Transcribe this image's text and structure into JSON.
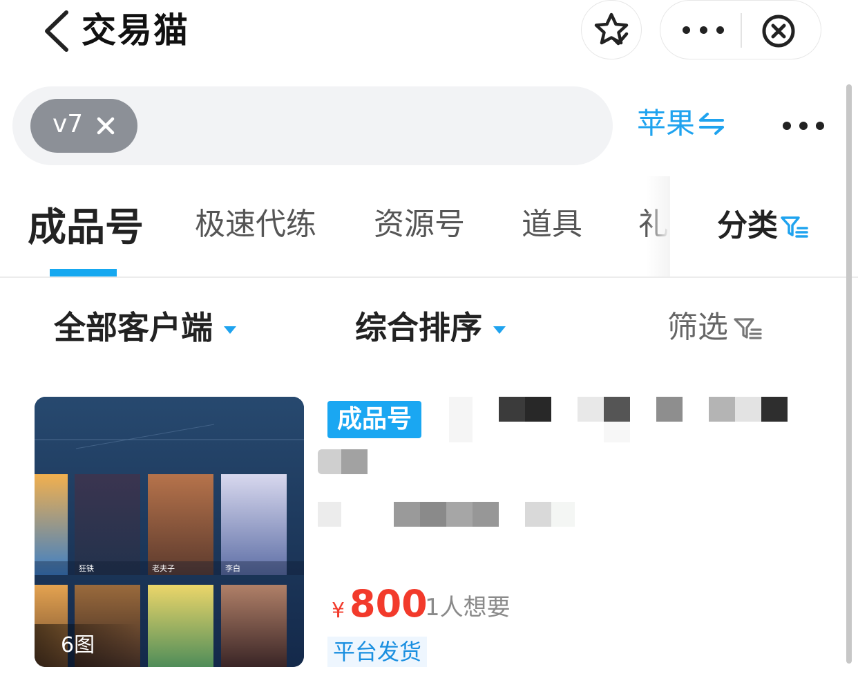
{
  "header": {
    "title": "交易猫",
    "back_icon": "chevron-left-icon",
    "favorite_icon": "star-check-icon",
    "more_icon": "more-dots-icon",
    "close_icon": "close-circle-icon"
  },
  "search": {
    "chip_label": "v7",
    "platform_label": "苹果",
    "platform_icon": "swap-icon"
  },
  "tabs": {
    "items": [
      "成品号",
      "极速代练",
      "资源号",
      "道具",
      "礼"
    ],
    "active_index": 0,
    "category_label": "分类",
    "accent": "#16a8f0"
  },
  "filters": {
    "client": "全部客户端",
    "sort": "综合排序",
    "screen": "筛选"
  },
  "listing": {
    "image_count": "6图",
    "badge": "成品号",
    "price_symbol": "¥",
    "price": "800",
    "wants": "1人想要",
    "shipping": "平台发货",
    "heroes": [
      "狂铁",
      "老夫子",
      "李白"
    ],
    "price_color": "#f23a2b"
  }
}
